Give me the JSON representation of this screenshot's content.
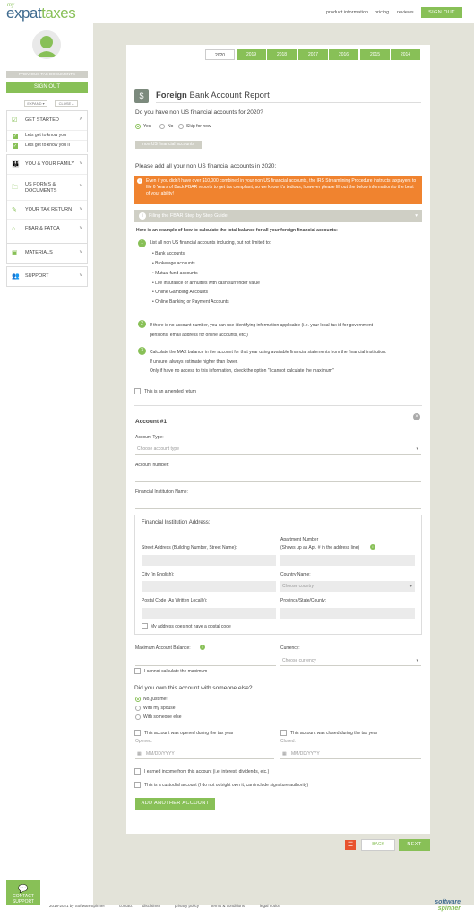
{
  "brand": {
    "my": "my",
    "name_a": "expat",
    "name_b": "taxes"
  },
  "topnav": {
    "product_info": "product information",
    "pricing": "pricing",
    "reviews": "reviews",
    "sign_out": "SIGN OUT"
  },
  "sidebar": {
    "previous_docs": "PREVIOUS TAX DOCUMENTS",
    "sign_out": "SIGN OUT",
    "expand": "EXPAND",
    "close": "CLOSE",
    "get_started": "GET STARTED",
    "sub_items": [
      "Lets get to know you",
      "Lets get to know you II"
    ],
    "items": [
      {
        "label": "YOU & YOUR FAMILY",
        "icon": "family-icon"
      },
      {
        "label": "US FORMS &",
        "label2": "DOCUMENTS",
        "icon": "documents-icon"
      },
      {
        "label": "YOUR TAX RETURN",
        "icon": "tax-return-icon"
      },
      {
        "label": "FBAR & FATCA",
        "icon": "bank-icon"
      },
      {
        "label": "MATERIALS",
        "icon": "materials-icon"
      },
      {
        "label": "SUPPORT",
        "icon": "support-icon"
      }
    ],
    "contact": "CONTACT",
    "contact2": "SUPPORT"
  },
  "years": [
    "2020",
    "2019",
    "2018",
    "2017",
    "2016",
    "2015",
    "2014"
  ],
  "page": {
    "title_bold": "Foreign",
    "title_rest": " Bank Account Report",
    "q1": "Do you have non US financial accounts for 2020?",
    "radio_yes": "Yes",
    "radio_no": "No",
    "radio_skip": "Skip for now",
    "tag": "non US financial accounts",
    "q2": "Please add all your non US financial accounts in 2020:",
    "warning": "Even if you didn't have over $10,000 combined in your non US financial accounts, the IRS Streamlining Procedure instructs taxpayers to file 6 Years of Back FBAR reports to get tax compliant, so we know it's tedious, however please fill out the below information to the best of your ability!",
    "guide_title": "Filing the FBAR Step by Step Guide:",
    "guide_intro": "Here is an example of how to calculate the total balance for all your foreign financial accounts:",
    "step1": "List all non US financial accounts including, but not limited to:",
    "step1_items": [
      "Bank accounts",
      "Brokerage accounts",
      "Mutual fund accounts",
      "Life insurance or annuities with cash surrender value",
      "Online Gambling Accounts",
      "Online Banking or Payment Accounts"
    ],
    "step2a": "If there is no account number, you can use identifying information applicable (i.e. your local tax id for government",
    "step2b": "pensions, email address for online accounts, etc.)",
    "step3a": "Calculate the MAX balance in the account for that year using available financial statements from the financial institution.",
    "step3b": "If unsure, always estimate higher than lower.",
    "step3c": "Only if have no access to this information, check the option \"I cannot calculate the maximum\"",
    "amended": "This is an amended return",
    "account_title": "Account #1",
    "account_type": "Account Type:",
    "account_type_ph": "Choose account type",
    "account_number": "Account number:",
    "institution_name": "Financial Institution Name:",
    "institution_address": "Financial Institution Address:",
    "street": "Street Address (Building Number, Street Name):",
    "apartment": "Apartment Number",
    "apartment2": "(Shows up as Apt. # in the address line)",
    "city": "City (in English):",
    "country": "Country Name:",
    "country_ph": "Choose country",
    "postal": "Postal Code (As Written Locally):",
    "province": "Province/State/County:",
    "no_postal": "My address does not have a postal code",
    "max_balance": "Maximum Account Balance:",
    "currency": "Currency:",
    "currency_ph": "Choose currency",
    "cannot_calc": "I cannot calculate the maximum",
    "own_q": "Did you own this account with someone else?",
    "own_no": "No, just me!",
    "own_spouse": "With my spouse",
    "own_else": "With someone else",
    "opened_chk": "This account was opened during the tax year",
    "opened": "Opened:",
    "closed_chk": "This account was closed during the tax year",
    "closed": "Closed:",
    "date_ph": "MM/DD/YYYY",
    "earned": "I earned income from this account (i.e. interest, dividends, etc.)",
    "custodial": "This is a custodial account (I do not outright own it, can include signature authority)",
    "add_another": "ADD ANOTHER ACCOUNT",
    "back": "BACK",
    "next": "NEXT"
  },
  "footer": {
    "copyright": "2018-2021 by SoftwareSpinner",
    "links": [
      "contact",
      "disclaimer",
      "privacy policy",
      "terms & conditions",
      "legal notice"
    ],
    "brand_a": "software",
    "brand_b": "spinner"
  },
  "colors": {
    "green": "#88c057",
    "blue": "#3f6b8f",
    "orange": "#f0832f",
    "bg": "#e3e3d9",
    "red": "#e8532f"
  }
}
